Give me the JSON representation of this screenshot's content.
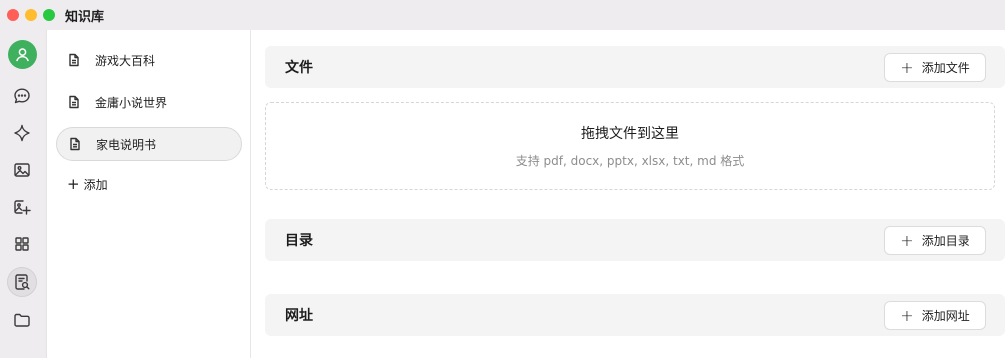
{
  "window": {
    "title": "知识库"
  },
  "rail": {
    "items": [
      {
        "icon": "chat-bubble-icon"
      },
      {
        "icon": "sparkle-icon"
      },
      {
        "icon": "image-icon"
      },
      {
        "icon": "image-edit-icon"
      },
      {
        "icon": "grid-apps-icon"
      },
      {
        "icon": "knowledge-base-icon",
        "active": true
      },
      {
        "icon": "folder-icon"
      }
    ]
  },
  "knowledge_bases": {
    "items": [
      {
        "label": "游戏大百科"
      },
      {
        "label": "金庸小说世界"
      },
      {
        "label": "家电说明书",
        "selected": true
      }
    ],
    "add_label": "添加"
  },
  "main": {
    "files": {
      "title": "文件",
      "add_label": "添加文件"
    },
    "dropzone": {
      "title": "拖拽文件到这里",
      "subtitle": "支持 pdf, docx, pptx, xlsx, txt, md 格式"
    },
    "directories": {
      "title": "目录",
      "add_label": "添加目录"
    },
    "urls": {
      "title": "网址",
      "add_label": "添加网址"
    }
  },
  "colors": {
    "avatar": "#3eb05e",
    "sidebar_bg": "#efecef",
    "section_bg": "#f4f4f4"
  }
}
